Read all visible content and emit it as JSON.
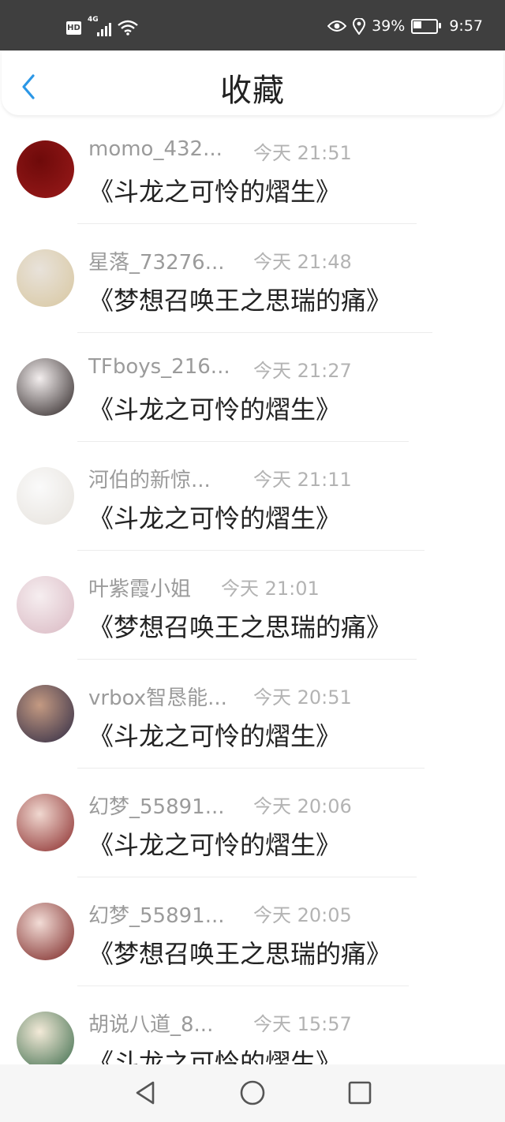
{
  "status_bar": {
    "hd": "HD",
    "network": "4G",
    "battery_percent": "39%",
    "clock": "9:57"
  },
  "header": {
    "title": "收藏",
    "back_icon": "chevron-left-icon",
    "accent_color": "#2b97e6"
  },
  "items": [
    {
      "name": "momo_432...",
      "time": "今天 21:51",
      "book": "《斗龙之可怜的熠生》",
      "avatar_colors": [
        "#6e0a0a",
        "#9a1a1a"
      ]
    },
    {
      "name": "星落_73276...",
      "time": "今天 21:48",
      "book": "《梦想召唤王之思瑞的痛》",
      "avatar_colors": [
        "#e8e2da",
        "#d8c7a0"
      ]
    },
    {
      "name": "TFboys_216...",
      "time": "今天 21:27",
      "book": "《斗龙之可怜的熠生》",
      "avatar_colors": [
        "#f3eeee",
        "#2a2222"
      ]
    },
    {
      "name": "河伯的新惊...",
      "time": "今天 21:11",
      "book": "《斗龙之可怜的熠生》",
      "avatar_colors": [
        "#fafafa",
        "#e6e2dc"
      ]
    },
    {
      "name": "叶紫霞小姐",
      "time": "今天 21:01",
      "book": "《梦想召唤王之思瑞的痛》",
      "avatar_colors": [
        "#f6eef0",
        "#d9b8c2"
      ]
    },
    {
      "name": "vrbox智恳能...",
      "time": "今天 20:51",
      "book": "《斗龙之可怜的熠生》",
      "avatar_colors": [
        "#c49a82",
        "#2e2a44"
      ]
    },
    {
      "name": "幻梦_55891...",
      "time": "今天 20:06",
      "book": "《斗龙之可怜的熠生》",
      "avatar_colors": [
        "#f0d8d0",
        "#8a2a2a"
      ]
    },
    {
      "name": "幻梦_55891...",
      "time": "今天 20:05",
      "book": "《梦想召唤王之思瑞的痛》",
      "avatar_colors": [
        "#f2dcd6",
        "#7a2422"
      ]
    },
    {
      "name": "胡说八道_8...",
      "time": "今天 15:57",
      "book": "《斗龙之可怜的熠生》",
      "avatar_colors": [
        "#f3ead8",
        "#3a6a4a"
      ]
    }
  ],
  "nav_bar": {
    "back": "triangle-back-icon",
    "home": "circle-home-icon",
    "recents": "square-recents-icon"
  }
}
